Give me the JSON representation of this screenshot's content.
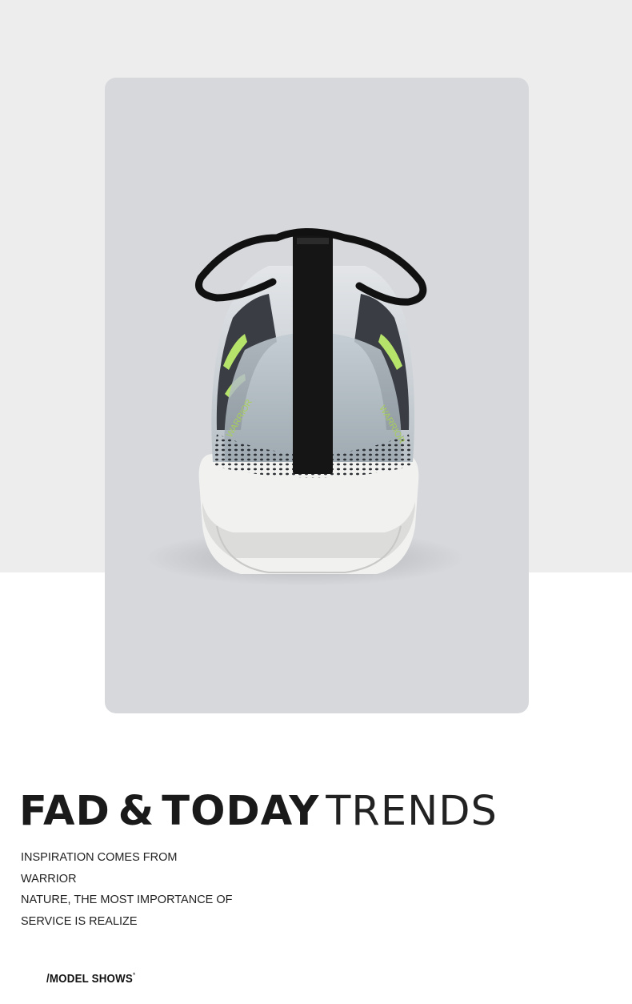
{
  "photo": {
    "description_icon": "sneaker-rear-view",
    "side_text_left": "WARRIOR",
    "side_text_right": "WARRIOR"
  },
  "headline": {
    "part1": "FAD",
    "amp": "&",
    "part2": "TODAY",
    "part3": "TRENDS"
  },
  "description": {
    "lines": [
      "INSPIRATION COMES FROM",
      "WARRIOR",
      "NATURE, THE MOST IMPORTANCE OF",
      "SERVICE IS REALIZE"
    ]
  },
  "footer": {
    "label": "/MODEL SHOWS",
    "mark": "*"
  },
  "colors": {
    "top_band": "#ededed",
    "card_bg": "#d6d8dc",
    "text_dark": "#1a1a1a",
    "accent_green": "#b6e36a"
  }
}
